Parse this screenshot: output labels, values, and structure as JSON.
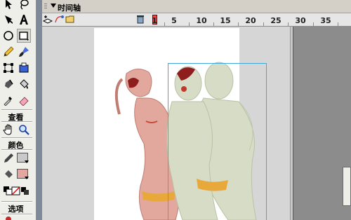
{
  "timeline": {
    "title": "时间轴",
    "frame_numbers": [
      "1",
      "5",
      "10",
      "15",
      "20",
      "25",
      "30",
      "35"
    ],
    "current_frame": 1
  },
  "tools_panel": {
    "view_section_label": "查看",
    "color_section_label": "颜色",
    "options_section_label": "选项",
    "tools": [
      "arrow-tool",
      "lasso-tool",
      "pen-tool",
      "text-tool",
      "oval-tool",
      "rectangle-tool",
      "pencil-tool",
      "brush-tool",
      "free-transform-tool",
      "fill-transform-tool",
      "ink-bottle-tool",
      "paint-bucket-tool",
      "eyedropper-tool",
      "eraser-tool",
      "hand-tool",
      "zoom-tool"
    ],
    "stroke_color": "#c9c9c9",
    "fill_color": "#e2a8a0"
  },
  "colors": {
    "pasteboard": "#d6d6d6",
    "stage": "#ffffff",
    "selection_box": "#3fa9dd",
    "figure_pink": "#e2a79d",
    "figure_green": "#d6dcc6",
    "hair_red": "#8e1d1d",
    "bikini_yellow": "#e8a83a"
  }
}
